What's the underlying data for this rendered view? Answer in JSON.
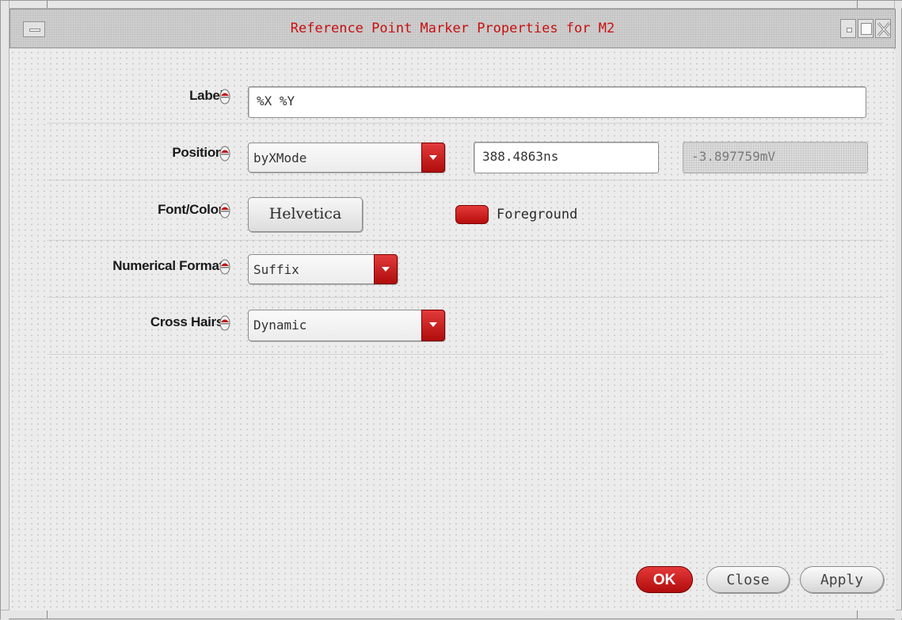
{
  "window": {
    "title": "Reference Point Marker Properties for M2"
  },
  "form": {
    "label": {
      "caption": "Label",
      "value": "%X %Y"
    },
    "position": {
      "caption": "Position",
      "mode": "byXMode",
      "x_value": "388.4863ns",
      "y_value": "-3.897759mV"
    },
    "font_color": {
      "caption": "Font/Color",
      "font_button": "Helvetica",
      "color_label": "Foreground",
      "color": "#cc1a1a"
    },
    "numerical_format": {
      "caption": "Numerical Format",
      "value": "Suffix"
    },
    "cross_hairs": {
      "caption": "Cross Hairs",
      "value": "Dynamic"
    }
  },
  "buttons": {
    "ok": "OK",
    "close": "Close",
    "apply": "Apply"
  },
  "icons": {
    "window_menu": "window-menu-icon",
    "minimize": "minimize-icon",
    "maximize": "maximize-icon",
    "close": "close-icon",
    "field_lock": "lock-toggle-icon",
    "dropdown": "chevron-down-icon"
  },
  "colors": {
    "accent": "#c81010",
    "title_text": "#c81010"
  }
}
